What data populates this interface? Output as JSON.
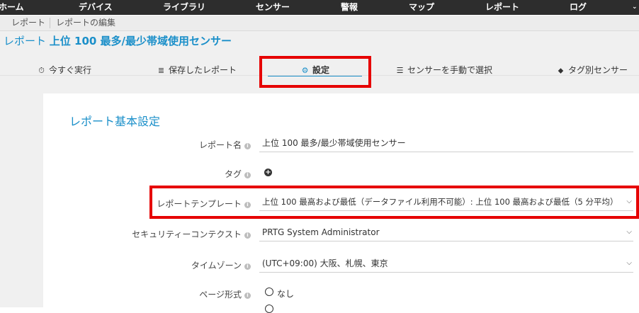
{
  "topnav": {
    "items": [
      "ホーム",
      "デバイス",
      "ライブラリ",
      "センサー",
      "警報",
      "マップ",
      "レポート",
      "ログ"
    ],
    "more": "⌄"
  },
  "breadcrumb": [
    "レポート",
    "レポートの編集"
  ],
  "page": {
    "title_prefix": "レポート",
    "title_main": "上位 100 最多/最少帯域使用センサー"
  },
  "tabs": [
    {
      "label": "今すぐ実行",
      "icon": "stopwatch-icon",
      "glyph": "⏱"
    },
    {
      "label": "保存したレポート",
      "icon": "database-icon",
      "glyph": "≣"
    },
    {
      "label": "設定",
      "icon": "gear-icon",
      "glyph": "⚙",
      "active": true
    },
    {
      "label": "センサーを手動で選択",
      "icon": "sliders-icon",
      "glyph": "☰"
    },
    {
      "label": "タグ別センサー",
      "icon": "tag-icon",
      "glyph": "⬥"
    }
  ],
  "section": {
    "title": "レポート基本設定"
  },
  "fields": {
    "report_name": {
      "label": "レポート名",
      "value": "上位 100 最多/最少帯域使用センサー"
    },
    "tags": {
      "label": "タグ"
    },
    "template": {
      "label": "レポートテンプレート",
      "value": "上位 100 最高および最低（データファイル利用不可能）: 上位 100 最高および最低（5 分平均）"
    },
    "security_context": {
      "label": "セキュリティーコンテクスト",
      "value": "PRTG System Administrator"
    },
    "timezone": {
      "label": "タイムゾーン",
      "value": "(UTC+09:00) 大阪、札幌、東京"
    },
    "page_format": {
      "label": "ページ形式",
      "options": [
        "なし"
      ]
    }
  },
  "colors": {
    "accent": "#1a8fc9",
    "highlight": "#e60000",
    "nav_bg": "#2d2d2d"
  }
}
